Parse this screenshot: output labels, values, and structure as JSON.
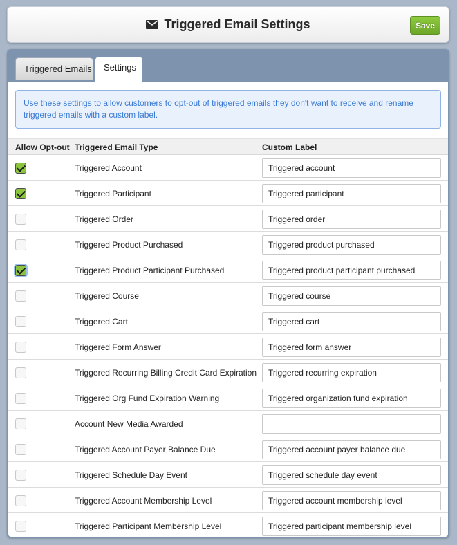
{
  "header": {
    "icon": "envelope-icon",
    "title": "Triggered Email Settings",
    "save_label": "Save"
  },
  "tabs": [
    {
      "label": "Triggered Emails",
      "active": false
    },
    {
      "label": "Settings",
      "active": true
    }
  ],
  "info_text": "Use these settings to allow customers to opt-out of triggered emails they don't want to receive and rename triggered emails with a custom label.",
  "table": {
    "headers": {
      "opt_out": "Allow Opt-out",
      "type": "Triggered Email Type",
      "label": "Custom Label"
    },
    "rows": [
      {
        "checked": true,
        "type": "Triggered Account",
        "label": "Triggered account"
      },
      {
        "checked": true,
        "type": "Triggered Participant",
        "label": "Triggered participant"
      },
      {
        "checked": false,
        "type": "Triggered Order",
        "label": "Triggered order"
      },
      {
        "checked": false,
        "type": "Triggered Product Purchased",
        "label": "Triggered product purchased"
      },
      {
        "checked": true,
        "type": "Triggered Product Participant Purchased",
        "label": "Triggered product participant purchased"
      },
      {
        "checked": false,
        "type": "Triggered Course",
        "label": "Triggered course"
      },
      {
        "checked": false,
        "type": "Triggered Cart",
        "label": "Triggered cart"
      },
      {
        "checked": false,
        "type": "Triggered Form Answer",
        "label": "Triggered form answer"
      },
      {
        "checked": false,
        "type": "Triggered Recurring Billing Credit Card Expiration",
        "label": "Triggered recurring expiration"
      },
      {
        "checked": false,
        "type": "Triggered Org Fund Expiration Warning",
        "label": "Triggered organization fund expiration"
      },
      {
        "checked": false,
        "type": "Account New Media Awarded",
        "label": ""
      },
      {
        "checked": false,
        "type": "Triggered Account Payer Balance Due",
        "label": "Triggered account payer balance due"
      },
      {
        "checked": false,
        "type": "Triggered Schedule Day Event",
        "label": "Triggered schedule day event"
      },
      {
        "checked": false,
        "type": "Triggered Account Membership Level",
        "label": "Triggered account membership level"
      },
      {
        "checked": false,
        "type": "Triggered Participant Membership Level",
        "label": "Triggered participant membership level"
      }
    ]
  },
  "colors": {
    "save_green": "#7ab833",
    "panel_blue": "#7d93ae",
    "info_text": "#3b7bd4",
    "checkbox_green": "#8cc43c"
  }
}
